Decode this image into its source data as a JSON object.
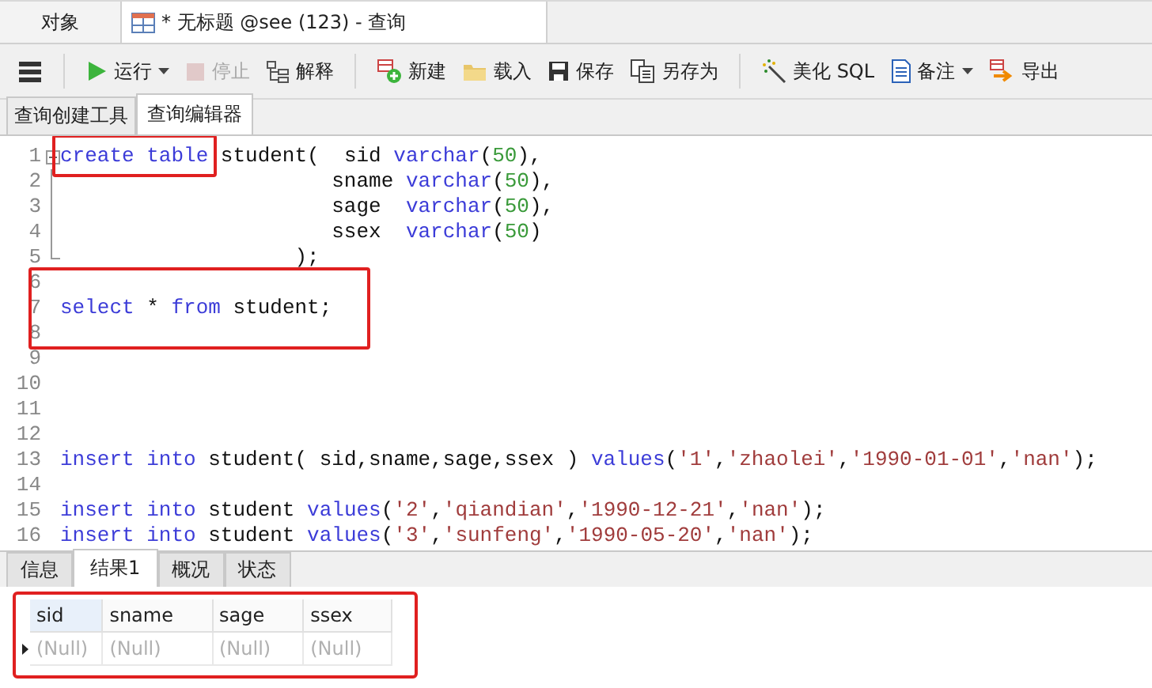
{
  "doc_tabs": [
    {
      "label": "对象",
      "selected": false
    },
    {
      "label": "* 无标题 @see (123) - 查询",
      "selected": true
    }
  ],
  "toolbar": [
    [
      {
        "kind": "menu",
        "dropdown": false,
        "disabled": false
      }
    ],
    [
      {
        "label": "运行",
        "kind": "run",
        "dropdown": true,
        "disabled": false
      },
      {
        "label": "停止",
        "kind": "stop",
        "dropdown": false,
        "disabled": true
      },
      {
        "label": "解释",
        "kind": "explain",
        "dropdown": false,
        "disabled": false
      }
    ],
    [
      {
        "label": "新建",
        "kind": "new",
        "dropdown": false,
        "disabled": false
      },
      {
        "label": "载入",
        "kind": "load",
        "dropdown": false,
        "disabled": false
      },
      {
        "label": "保存",
        "kind": "save",
        "dropdown": false,
        "disabled": false
      },
      {
        "label": "另存为",
        "kind": "saveas",
        "dropdown": false,
        "disabled": false
      }
    ],
    [
      {
        "label": "美化 SQL",
        "kind": "beautify",
        "dropdown": false,
        "disabled": false
      },
      {
        "label": "备注",
        "kind": "note",
        "dropdown": true,
        "disabled": false
      },
      {
        "label": "导出",
        "kind": "export",
        "dropdown": false,
        "disabled": false
      }
    ]
  ],
  "editor_tabs": [
    {
      "label": "查询创建工具",
      "selected": false
    },
    {
      "label": "查询编辑器",
      "selected": true
    }
  ],
  "editor": {
    "blocks": [
      {
        "boxed": false,
        "lines": [
          {
            "number": "1",
            "kind": "foldstart",
            "tokens": [
              {
                "kind": "keyword",
                "t": "create table",
                "boxed": true
              },
              {
                "kind": "plain",
                "t": " student(  sid "
              },
              {
                "kind": "keyword",
                "t": "varchar"
              },
              {
                "kind": "plain",
                "t": "("
              },
              {
                "kind": "number",
                "t": "50"
              },
              {
                "kind": "plain",
                "t": "),"
              }
            ]
          },
          {
            "number": "2",
            "kind": "foldbody",
            "tokens": [
              {
                "kind": "plain",
                "t": "                      sname "
              },
              {
                "kind": "keyword",
                "t": "varchar"
              },
              {
                "kind": "plain",
                "t": "("
              },
              {
                "kind": "number",
                "t": "50"
              },
              {
                "kind": "plain",
                "t": "),"
              }
            ]
          },
          {
            "number": "3",
            "kind": "foldbody",
            "tokens": [
              {
                "kind": "plain",
                "t": "                      sage  "
              },
              {
                "kind": "keyword",
                "t": "varchar"
              },
              {
                "kind": "plain",
                "t": "("
              },
              {
                "kind": "number",
                "t": "50"
              },
              {
                "kind": "plain",
                "t": "),"
              }
            ]
          },
          {
            "number": "4",
            "kind": "foldbody",
            "tokens": [
              {
                "kind": "plain",
                "t": "                      ssex  "
              },
              {
                "kind": "keyword",
                "t": "varchar"
              },
              {
                "kind": "plain",
                "t": "("
              },
              {
                "kind": "number",
                "t": "50"
              },
              {
                "kind": "plain",
                "t": ")"
              }
            ]
          },
          {
            "number": "5",
            "kind": "foldend",
            "tokens": [
              {
                "kind": "plain",
                "t": "                   );"
              }
            ]
          }
        ]
      },
      {
        "boxed": true,
        "lines": [
          {
            "number": "6",
            "kind": "plain"
          },
          {
            "number": "7",
            "kind": "plain",
            "tokens": [
              {
                "kind": "keyword",
                "t": "select"
              },
              {
                "kind": "plain",
                "t": " * "
              },
              {
                "kind": "keyword",
                "t": "from"
              },
              {
                "kind": "plain",
                "t": " student;"
              }
            ]
          },
          {
            "number": "8",
            "kind": "plain"
          }
        ]
      },
      {
        "boxed": false,
        "lines": [
          {
            "number": "9",
            "kind": "plain"
          },
          {
            "number": "10",
            "kind": "plain"
          },
          {
            "number": "11",
            "kind": "plain"
          },
          {
            "number": "12",
            "kind": "plain"
          },
          {
            "number": "13",
            "kind": "plain",
            "tokens": [
              {
                "kind": "keyword",
                "t": "insert into"
              },
              {
                "kind": "plain",
                "t": " student( sid,sname,sage,ssex ) "
              },
              {
                "kind": "keyword",
                "t": "values"
              },
              {
                "kind": "plain",
                "t": "("
              },
              {
                "kind": "string",
                "t": "'1'"
              },
              {
                "kind": "plain",
                "t": ","
              },
              {
                "kind": "string",
                "t": "'zhaolei'"
              },
              {
                "kind": "plain",
                "t": ","
              },
              {
                "kind": "string",
                "t": "'1990-01-01'"
              },
              {
                "kind": "plain",
                "t": ","
              },
              {
                "kind": "string",
                "t": "'nan'"
              },
              {
                "kind": "plain",
                "t": ");"
              }
            ]
          },
          {
            "number": "14",
            "kind": "plain"
          },
          {
            "number": "15",
            "kind": "plain",
            "tokens": [
              {
                "kind": "keyword",
                "t": "insert into"
              },
              {
                "kind": "plain",
                "t": " student "
              },
              {
                "kind": "keyword",
                "t": "values"
              },
              {
                "kind": "plain",
                "t": "("
              },
              {
                "kind": "string",
                "t": "'2'"
              },
              {
                "kind": "plain",
                "t": ","
              },
              {
                "kind": "string",
                "t": "'qiandian'"
              },
              {
                "kind": "plain",
                "t": ","
              },
              {
                "kind": "string",
                "t": "'1990-12-21'"
              },
              {
                "kind": "plain",
                "t": ","
              },
              {
                "kind": "string",
                "t": "'nan'"
              },
              {
                "kind": "plain",
                "t": ");"
              }
            ]
          },
          {
            "number": "16",
            "kind": "plain",
            "tokens": [
              {
                "kind": "keyword",
                "t": "insert into"
              },
              {
                "kind": "plain",
                "t": " student "
              },
              {
                "kind": "keyword",
                "t": "values"
              },
              {
                "kind": "plain",
                "t": "("
              },
              {
                "kind": "string",
                "t": "'3'"
              },
              {
                "kind": "plain",
                "t": ","
              },
              {
                "kind": "string",
                "t": "'sunfeng'"
              },
              {
                "kind": "plain",
                "t": ","
              },
              {
                "kind": "string",
                "t": "'1990-05-20'"
              },
              {
                "kind": "plain",
                "t": ","
              },
              {
                "kind": "string",
                "t": "'nan'"
              },
              {
                "kind": "plain",
                "t": ");"
              }
            ]
          }
        ]
      }
    ]
  },
  "result_tabs": [
    {
      "label": "信息",
      "selected": false
    },
    {
      "label": "结果1",
      "selected": true
    },
    {
      "label": "概况",
      "selected": false
    },
    {
      "label": "状态",
      "selected": false
    }
  ],
  "result": {
    "boxed": true,
    "columns": [
      "sid",
      "sname",
      "sage",
      "ssex"
    ],
    "rows": [
      {
        "current": true,
        "cells": [
          "(Null)",
          "(Null)",
          "(Null)",
          "(Null)"
        ]
      }
    ]
  }
}
